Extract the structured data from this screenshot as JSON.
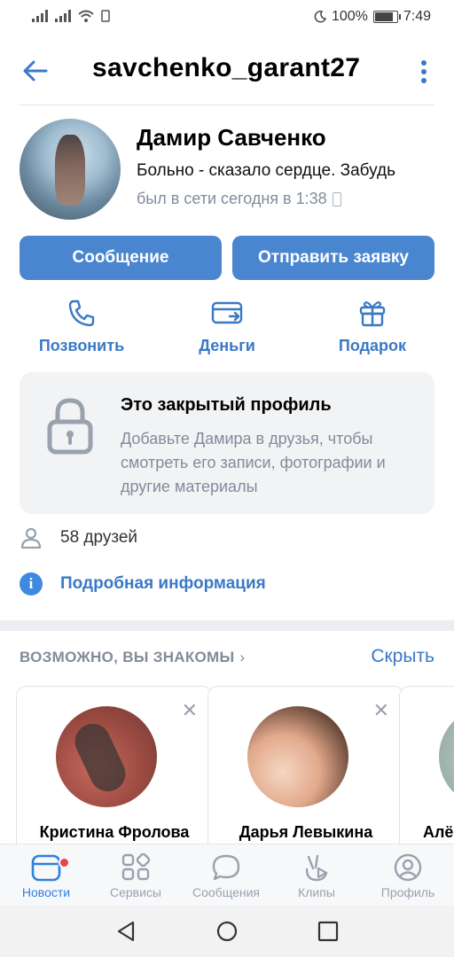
{
  "statusbar": {
    "battery": "100%",
    "time": "7:49"
  },
  "header": {
    "title": "savchenko_garant27"
  },
  "profile": {
    "name": "Дамир Савченко",
    "status": "Больно - сказало сердце. Забудь",
    "online": "был в сети сегодня в 1:38"
  },
  "buttons": {
    "message": "Сообщение",
    "request": "Отправить заявку"
  },
  "actions": {
    "call": "Позвонить",
    "money": "Деньги",
    "gift": "Подарок"
  },
  "closed_profile": {
    "title": "Это закрытый профиль",
    "text": "Добавьте Дамира в друзья, чтобы смотреть его записи, фотографии и другие материалы"
  },
  "friends": {
    "label": "58 друзей"
  },
  "info": {
    "label": "Подробная информация"
  },
  "suggestions": {
    "heading": "ВОЗМОЖНО, ВЫ ЗНАКОМЫ",
    "hide": "Скрыть",
    "people": [
      {
        "name": "Кристина Фролова"
      },
      {
        "name": "Дарья Левыкина"
      },
      {
        "name": "Алён"
      }
    ]
  },
  "tabs": [
    {
      "label": "Новости",
      "active": true
    },
    {
      "label": "Сервисы",
      "active": false
    },
    {
      "label": "Сообщения",
      "active": false
    },
    {
      "label": "Клипы",
      "active": false
    },
    {
      "label": "Профиль",
      "active": false
    }
  ],
  "colors": {
    "accent": "#4a86d0",
    "link": "#3a79c6",
    "muted": "#818c99",
    "badge": "#e64646"
  }
}
